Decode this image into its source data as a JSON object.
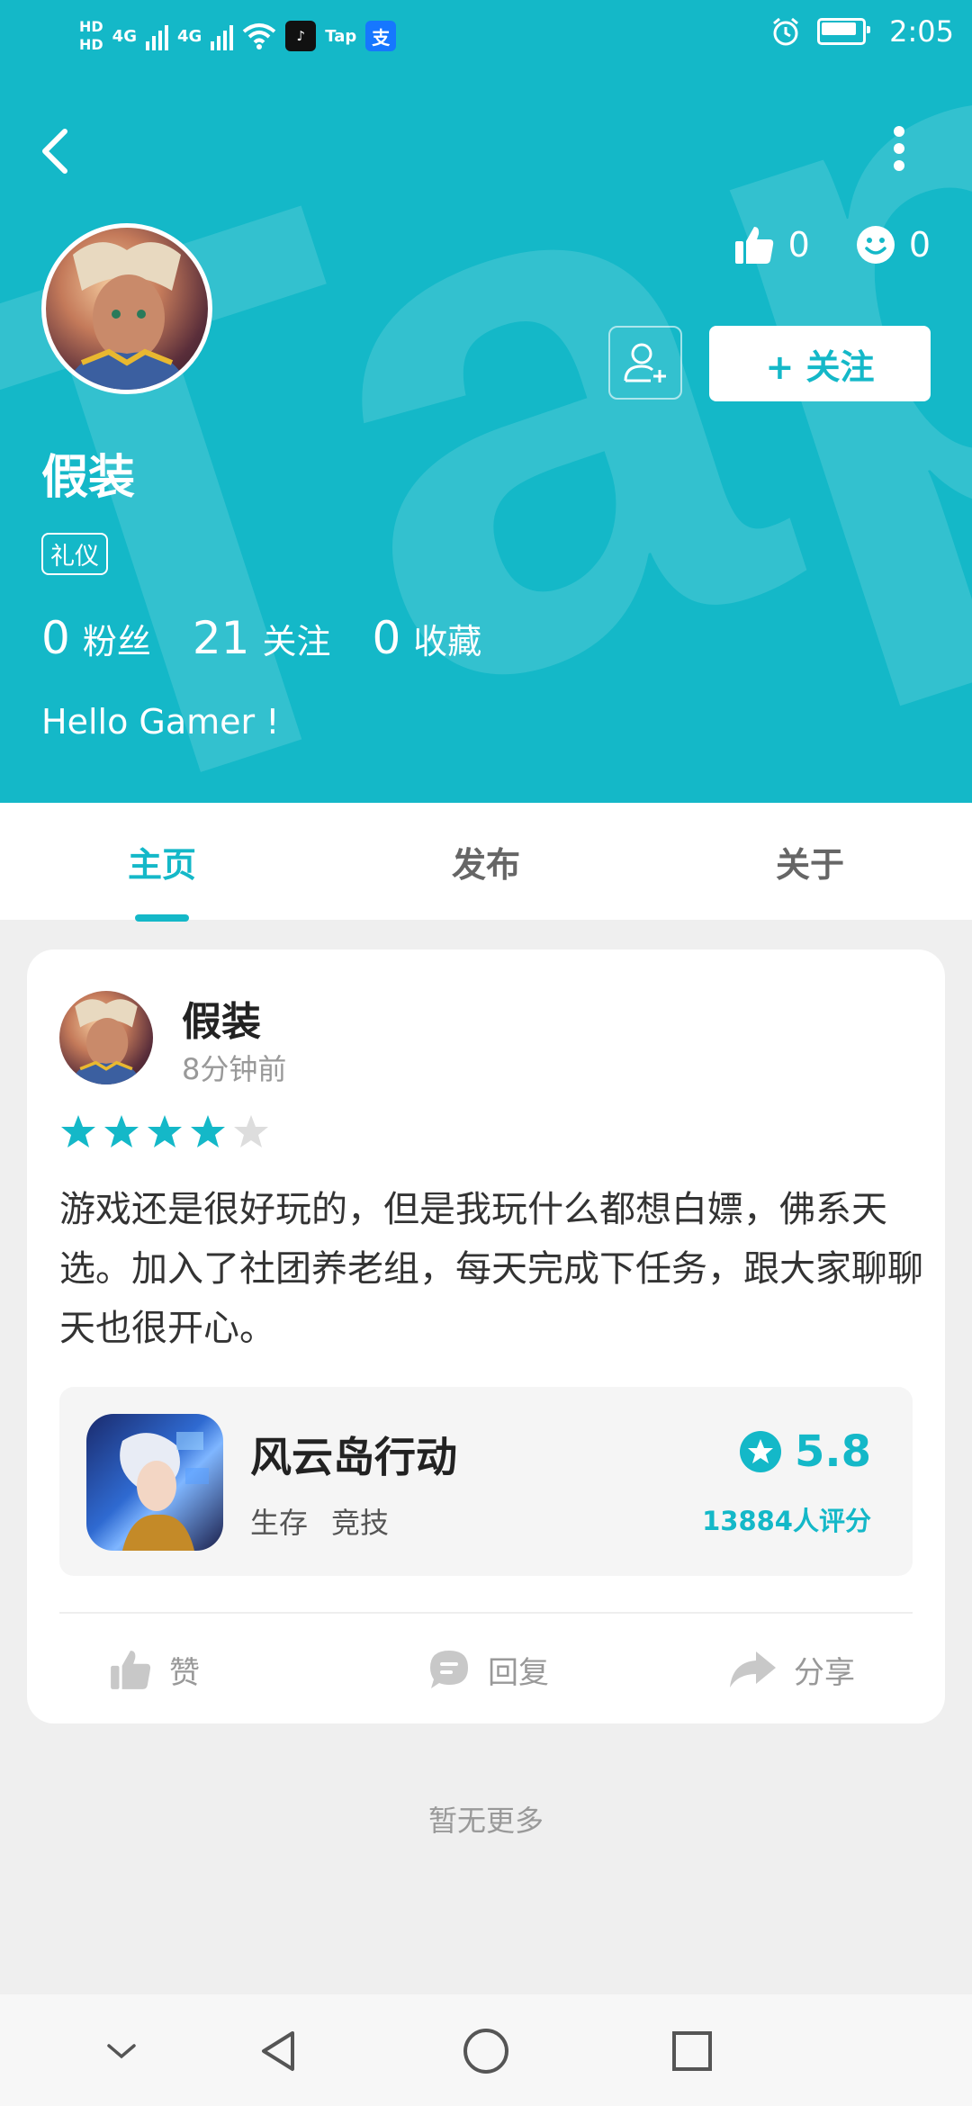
{
  "status_bar": {
    "hd1": "HD",
    "hd2": "HD",
    "net1": "4G",
    "net2": "4G",
    "tap_label": "Tap",
    "alipay_label": "支",
    "time": "2:05"
  },
  "profile": {
    "name": "假装",
    "tag": "礼仪",
    "likes": "0",
    "smiles": "0",
    "follow_label": "+ 关注",
    "fans_count": "0",
    "fans_label": "粉丝",
    "following_count": "21",
    "following_label": "关注",
    "favorites_count": "0",
    "favorites_label": "收藏",
    "bio": "Hello Gamer !"
  },
  "tabs": [
    {
      "label": "主页",
      "active": true
    },
    {
      "label": "发布",
      "active": false
    },
    {
      "label": "关于",
      "active": false
    }
  ],
  "post": {
    "author": "假装",
    "time": "8分钟前",
    "rating": 4,
    "rating_max": 5,
    "text": "游戏还是很好玩的，但是我玩什么都想白嫖，佛系天选。加入了社团养老组，每天完成下任务，跟大家聊聊天也很开心。",
    "game": {
      "name": "风云岛行动",
      "tags": [
        "生存",
        "竞技"
      ],
      "score": "5.8",
      "rating_count": "13884人评分"
    },
    "actions": {
      "like": "赞",
      "reply": "回复",
      "share": "分享"
    }
  },
  "footer_text": "暂无更多",
  "colors": {
    "accent": "#14b8c8",
    "star_empty": "#dddddd"
  }
}
